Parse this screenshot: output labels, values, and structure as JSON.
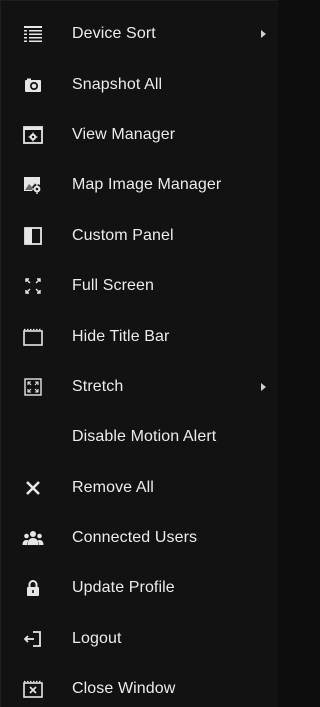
{
  "menu": {
    "items": [
      {
        "label": "Device Sort",
        "icon": "list-icon",
        "submenu": true
      },
      {
        "label": "Snapshot All",
        "icon": "camera-icon",
        "submenu": false
      },
      {
        "label": "View Manager",
        "icon": "view-manager-icon",
        "submenu": false
      },
      {
        "label": "Map Image Manager",
        "icon": "map-image-icon",
        "submenu": false
      },
      {
        "label": "Custom Panel",
        "icon": "panel-icon",
        "submenu": false
      },
      {
        "label": "Full Screen",
        "icon": "fullscreen-icon",
        "submenu": false
      },
      {
        "label": "Hide Title Bar",
        "icon": "title-bar-icon",
        "submenu": false
      },
      {
        "label": "Stretch",
        "icon": "stretch-icon",
        "submenu": true
      },
      {
        "label": "Disable Motion Alert",
        "icon": "",
        "submenu": false
      },
      {
        "label": "Remove All",
        "icon": "x-icon",
        "submenu": false
      },
      {
        "label": "Connected Users",
        "icon": "users-icon",
        "submenu": false
      },
      {
        "label": "Update Profile",
        "icon": "lock-icon",
        "submenu": false
      },
      {
        "label": "Logout",
        "icon": "logout-icon",
        "submenu": false
      },
      {
        "label": "Close Window",
        "icon": "close-window-icon",
        "submenu": false
      }
    ]
  },
  "colors": {
    "background": "#121212",
    "text": "#ececec",
    "icon": "#e6e6e6"
  }
}
